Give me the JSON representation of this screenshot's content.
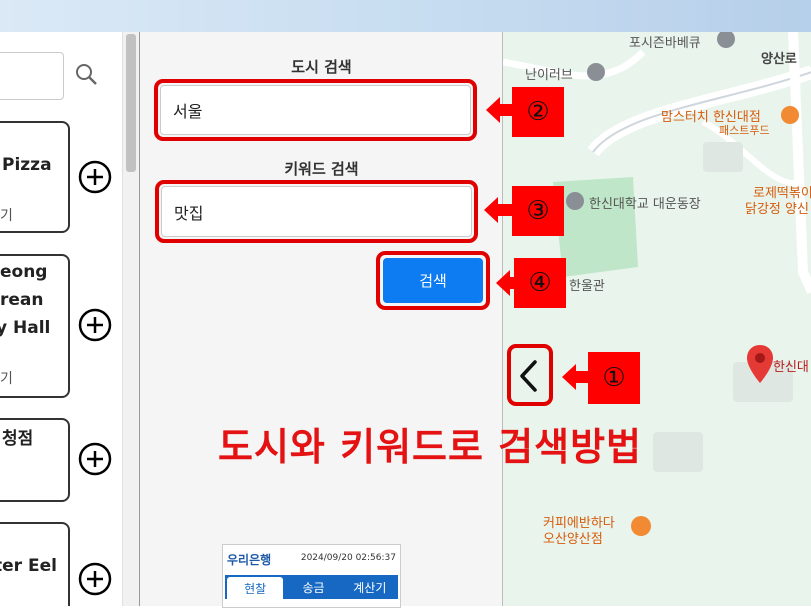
{
  "left_panel": {
    "cards": [
      {
        "title": "Pizza",
        "sub": "기"
      },
      {
        "title_lines": [
          "eong",
          "rean",
          "y Hall"
        ],
        "sub": "기"
      },
      {
        "title": "청점",
        "sub": ""
      },
      {
        "title": "ter Eel",
        "sub": ""
      }
    ]
  },
  "form": {
    "city_label": "도시 검색",
    "city_value": "서울",
    "keyword_label": "키워드 검색",
    "keyword_value": "맛집",
    "search_button": "검색"
  },
  "map": {
    "pois": [
      {
        "name": "포시즌바베큐",
        "kind": "gray"
      },
      {
        "name": "양산로",
        "kind": "road"
      },
      {
        "name": "난이러브",
        "kind": "gray"
      },
      {
        "name": "맘스터치 한신대점",
        "kind": "orange",
        "sub": "패스트푸드"
      },
      {
        "name": "한신대학교 대운동장",
        "kind": "gray"
      },
      {
        "name": "로제떡볶이",
        "kind": "orange"
      },
      {
        "name": "닭강정 양신",
        "kind": "orange"
      },
      {
        "name": "한울관",
        "kind": "gray"
      },
      {
        "name": "한신대",
        "kind": "red"
      },
      {
        "name": "커피에반하다",
        "kind": "orange"
      },
      {
        "name": "오산양산점",
        "kind": "orange"
      }
    ]
  },
  "annotations": {
    "badges": [
      "①",
      "②",
      "③",
      "④"
    ],
    "title": "도시와 키워드로 검색방법"
  },
  "bank_widget": {
    "brand": "우리은행",
    "datetime": "2024/09/20 02:56:37",
    "tabs": [
      "현찰",
      "송금",
      "계산기"
    ]
  },
  "colors": {
    "highlight": "#e00000",
    "button": "#0d7cf2",
    "badge": "#ff0000"
  }
}
